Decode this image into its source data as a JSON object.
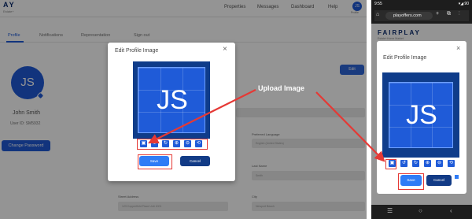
{
  "desktop": {
    "brand": "AY",
    "brand_sub": "Estate+",
    "nav": {
      "properties": "Properties",
      "messages": "Messages",
      "dashboard": "Dashboard",
      "help": "Help"
    },
    "avatar_initials": "JS",
    "avatar_label": "Profile",
    "tabs": [
      "Profile",
      "Notifications",
      "Representation",
      "Sign out"
    ],
    "profile": {
      "initials": "JS",
      "name": "John Smith",
      "user_id": "User ID: SM5932"
    },
    "change_password_label": "Change Password",
    "edit_label": "Edit",
    "fields": {
      "preferred_language_label": "Preferred Language",
      "preferred_language_value": "English (United States)",
      "last_name_label": "Last Name",
      "last_name_value": "Smith",
      "street_address_label": "Street Address",
      "street_address_value": "123 Copperfield Place Unit 1001",
      "city_label": "City",
      "city_value": "Newport Beach"
    },
    "modal": {
      "title": "Edit Profile Image",
      "close": "×",
      "preview_initials": "JS",
      "tools": [
        {
          "icon": "image-upload-icon",
          "glyph": "▣"
        },
        {
          "icon": "rotate-left-icon",
          "glyph": "↺"
        },
        {
          "icon": "rotate-right-icon",
          "glyph": "↻"
        },
        {
          "icon": "zoom-in-icon",
          "glyph": "⊕"
        },
        {
          "icon": "zoom-out-icon",
          "glyph": "⊖"
        },
        {
          "icon": "reset-icon",
          "glyph": "⟲"
        }
      ],
      "save_label": "Save",
      "cancel_label": "Cancel"
    }
  },
  "annotation": {
    "label": "Upload Image",
    "color": "#e53935"
  },
  "mobile": {
    "time": "9:55",
    "status_right": "▾◢ 90",
    "url": "playoffers.com",
    "url_icons": "+ ⧉ ⋮",
    "brand": "FAIRPLAY",
    "brand_sub": "Estate+Home Market",
    "modal": {
      "title": "Edit Profile Image",
      "close": "×",
      "preview_initials": "JS",
      "save_label": "Save",
      "cancel_label": "Cancel"
    },
    "nav": {
      "menu": "☰",
      "home": "○",
      "back": "‹"
    }
  },
  "colors": {
    "primary": "#1f5bd8",
    "dark_blue": "#123b86",
    "save_blue": "#2f7cf6",
    "highlight_red": "#e53935"
  }
}
